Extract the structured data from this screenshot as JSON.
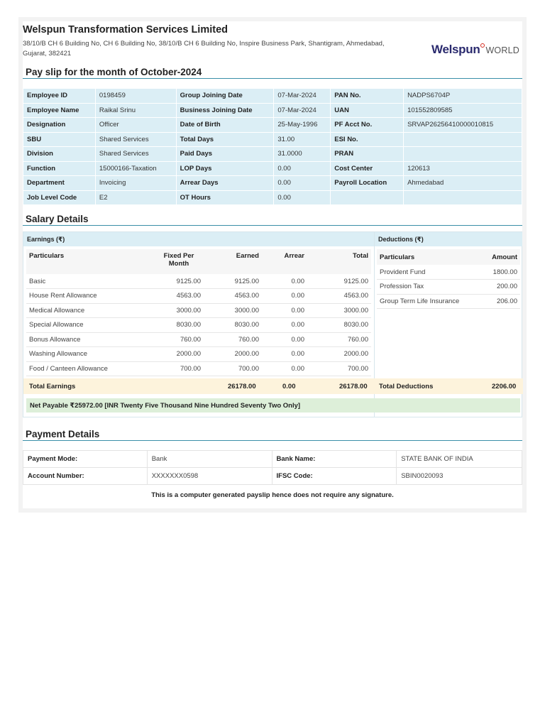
{
  "company": {
    "name": "Welspun Transformation Services Limited",
    "address": "38/10/B CH 6 Building No, CH 6 Building No, 38/10/B CH 6 Building No, Inspire Business Park, Shantigram, Ahmedabad, Gujarat, 382421",
    "logo_main": "Welspun",
    "logo_sub": "WORLD"
  },
  "payslip_title": "Pay slip for the month of October-2024",
  "employee": {
    "rows": [
      [
        "Employee ID",
        "0198459",
        "Group Joining Date",
        "07-Mar-2024",
        "PAN No.",
        "NADPS6704P"
      ],
      [
        "Employee Name",
        "Raikal Srinu",
        "Business Joining Date",
        "07-Mar-2024",
        "UAN",
        "101552809585"
      ],
      [
        "Designation",
        "Officer",
        "Date of Birth",
        "25-May-1996",
        "PF Acct No.",
        "SRVAP26256410000010815"
      ],
      [
        "SBU",
        "Shared Services",
        "Total Days",
        "31.00",
        "ESI No.",
        ""
      ],
      [
        "Division",
        "Shared Services",
        "Paid Days",
        "31.0000",
        "PRAN",
        ""
      ],
      [
        "Function",
        "15000166-Taxation",
        "LOP Days",
        "0.00",
        "Cost Center",
        "120613"
      ],
      [
        "Department",
        "Invoicing",
        "Arrear Days",
        "0.00",
        "Payroll Location",
        "Ahmedabad"
      ],
      [
        "Job Level Code",
        "E2",
        "OT Hours",
        "0.00",
        "",
        ""
      ]
    ]
  },
  "salary_title": "Salary Details",
  "earnings": {
    "heading": "Earnings (₹)",
    "columns": [
      "Particulars",
      "Fixed Per Month",
      "Earned",
      "Arrear",
      "Total"
    ],
    "rows": [
      [
        "Basic",
        "9125.00",
        "9125.00",
        "0.00",
        "9125.00"
      ],
      [
        "House Rent Allowance",
        "4563.00",
        "4563.00",
        "0.00",
        "4563.00"
      ],
      [
        "Medical Allowance",
        "3000.00",
        "3000.00",
        "0.00",
        "3000.00"
      ],
      [
        "Special Allowance",
        "8030.00",
        "8030.00",
        "0.00",
        "8030.00"
      ],
      [
        "Bonus Allowance",
        "760.00",
        "760.00",
        "0.00",
        "760.00"
      ],
      [
        "Washing Allowance",
        "2000.00",
        "2000.00",
        "0.00",
        "2000.00"
      ],
      [
        "Food / Canteen Allowance",
        "700.00",
        "700.00",
        "0.00",
        "700.00"
      ]
    ],
    "total_label": "Total Earnings",
    "total_earned": "26178.00",
    "total_arrear": "0.00",
    "total_total": "26178.00"
  },
  "deductions": {
    "heading": "Deductions (₹)",
    "columns": [
      "Particulars",
      "Amount"
    ],
    "rows": [
      [
        "Provident Fund",
        "1800.00"
      ],
      [
        "Profession Tax",
        "200.00"
      ],
      [
        "Group Term Life Insurance",
        "206.00"
      ]
    ],
    "total_label": "Total Deductions",
    "total_amount": "2206.00"
  },
  "net_payable": "Net Payable ₹25972.00   [INR Twenty Five Thousand Nine Hundred Seventy Two Only]",
  "payment_title": "Payment Details",
  "payment": {
    "mode_label": "Payment Mode:",
    "mode_value": "Bank",
    "bank_label": "Bank Name:",
    "bank_value": "STATE BANK OF INDIA",
    "account_label": "Account Number:",
    "account_value": "XXXXXXX0598",
    "ifsc_label": "IFSC Code:",
    "ifsc_value": "SBIN0020093"
  },
  "footer": "This is a computer generated payslip hence does not require any signature."
}
